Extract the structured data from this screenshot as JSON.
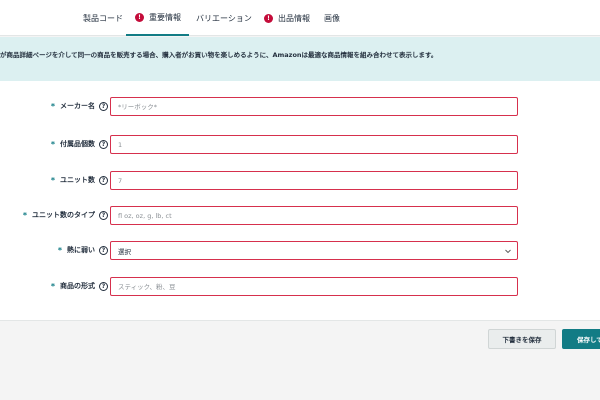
{
  "tabs": [
    {
      "label": "製品コード",
      "alert": false
    },
    {
      "label": "重要情報",
      "alert": true,
      "alert_symbol": "!"
    },
    {
      "label": "バリエーション",
      "alert": false
    },
    {
      "label": "出品情報",
      "alert": true,
      "alert_symbol": "!"
    },
    {
      "label": "画像",
      "alert": false
    }
  ],
  "banner": {
    "text": "が商品詳細ページを介して同一の商品を販売する場合、購入者がお買い物を楽しめるように、Amazonは最適な商品情報を組み合わせて表示します。"
  },
  "form": {
    "required_mark": "*",
    "help_symbol": "?",
    "fields": [
      {
        "label": "メーカー名",
        "placeholder": "*リーボック*",
        "value": "",
        "type": "text"
      },
      {
        "label": "付属品個数",
        "placeholder": "1",
        "value": "",
        "type": "text"
      },
      {
        "label": "ユニット数",
        "placeholder": "7",
        "value": "",
        "type": "text"
      },
      {
        "label": "ユニット数のタイプ",
        "placeholder": "fl oz, oz, g, lb, ct",
        "value": "",
        "type": "text"
      },
      {
        "label": "熱に弱い",
        "value": "選択",
        "type": "select"
      },
      {
        "label": "商品の形式",
        "placeholder": "スティック、粉、豆",
        "value": "",
        "type": "text"
      }
    ]
  },
  "footer": {
    "save_draft_label": "下書きを保存",
    "save_label": "保存して"
  },
  "colors": {
    "accent": "#127c85",
    "error_border": "#d6304d",
    "alert": "#c40c3a",
    "banner_bg": "#dcf0f1"
  },
  "icons": {
    "tab_alert": "exclamation-circle-icon",
    "help": "question-circle-icon",
    "select": "chevron-down-icon"
  }
}
